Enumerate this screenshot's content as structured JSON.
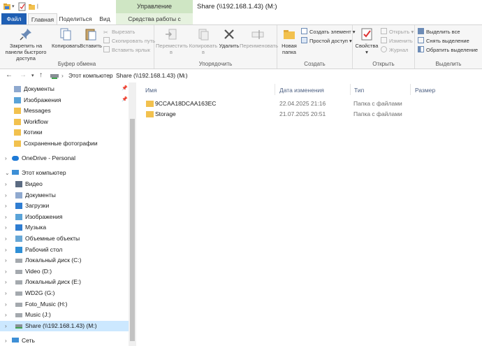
{
  "window": {
    "title": "Share (\\\\192.168.1.43) (M:)",
    "context_tab_group": "Управление"
  },
  "tabs": {
    "file": "Файл",
    "home": "Главная",
    "share": "Поделиться",
    "view": "Вид",
    "drive_tools": "Средства работы с дисками"
  },
  "ribbon": {
    "clipboard": {
      "label": "Буфер обмена",
      "pin": "Закрепить на панели быстрого доступа",
      "copy": "Копировать",
      "paste": "Вставить",
      "cut": "Вырезать",
      "copy_path": "Скопировать путь",
      "paste_shortcut": "Вставить ярлык"
    },
    "organize": {
      "label": "Упорядочить",
      "move_to": "Переместить в",
      "copy_to": "Копировать в",
      "delete": "Удалить",
      "rename": "Переименовать"
    },
    "new": {
      "label": "Создать",
      "new_folder": "Новая папка",
      "new_item": "Создать элемент",
      "easy_access": "Простой доступ"
    },
    "open": {
      "label": "Открыть",
      "properties": "Свойства",
      "open": "Открыть",
      "edit": "Изменить",
      "history": "Журнал"
    },
    "select": {
      "label": "Выделить",
      "select_all": "Выделить все",
      "select_none": "Снять выделение",
      "invert": "Обратить выделение"
    }
  },
  "address": {
    "crumbs": [
      "Этот компьютер",
      "Share (\\\\192.168.1.43) (M:)"
    ]
  },
  "nav": {
    "quick_access": [
      {
        "label": "Документы",
        "icon": "documents-icon",
        "pinned": true
      },
      {
        "label": "Изображения",
        "icon": "pictures-icon",
        "pinned": true
      },
      {
        "label": "Messages",
        "icon": "folder-icon",
        "pinned": false
      },
      {
        "label": "Workflow",
        "icon": "folder-icon",
        "pinned": false
      },
      {
        "label": "Котики",
        "icon": "folder-icon",
        "pinned": false
      },
      {
        "label": "Сохраненные фотографии",
        "icon": "folder-icon",
        "pinned": false
      }
    ],
    "onedrive": "OneDrive - Personal",
    "this_pc": "Этот компьютер",
    "pc_items": [
      {
        "label": "Видео",
        "icon": "video-icon"
      },
      {
        "label": "Документы",
        "icon": "documents-icon"
      },
      {
        "label": "Загрузки",
        "icon": "downloads-icon"
      },
      {
        "label": "Изображения",
        "icon": "pictures-icon"
      },
      {
        "label": "Музыка",
        "icon": "music-icon"
      },
      {
        "label": "Объемные объекты",
        "icon": "3d-objects-icon"
      },
      {
        "label": "Рабочий стол",
        "icon": "desktop-icon"
      },
      {
        "label": "Локальный диск (C:)",
        "icon": "drive-icon"
      },
      {
        "label": "Video (D:)",
        "icon": "drive-icon"
      },
      {
        "label": "Локальный диск (E:)",
        "icon": "drive-icon"
      },
      {
        "label": "WD2G (G:)",
        "icon": "drive-icon"
      },
      {
        "label": "Foto_Music (H:)",
        "icon": "drive-icon"
      },
      {
        "label": "Music (J:)",
        "icon": "drive-icon"
      },
      {
        "label": "Share (\\\\192.168.1.43) (M:)",
        "icon": "network-drive-icon",
        "selected": true
      }
    ],
    "network": "Сеть"
  },
  "columns": {
    "name": "Имя",
    "date": "Дата изменения",
    "type": "Тип",
    "size": "Размер"
  },
  "files": [
    {
      "name": "9CCAA18DCAA163EC",
      "date": "22.04.2025 21:16",
      "type": "Папка с файлами"
    },
    {
      "name": "Storage",
      "date": "21.07.2025 20:51",
      "type": "Папка с файлами"
    }
  ],
  "colors": {
    "accent": "#1f5fb4",
    "selection": "#cce8ff",
    "folder": "#f2c14e",
    "context_tab": "#cfe6c4"
  }
}
